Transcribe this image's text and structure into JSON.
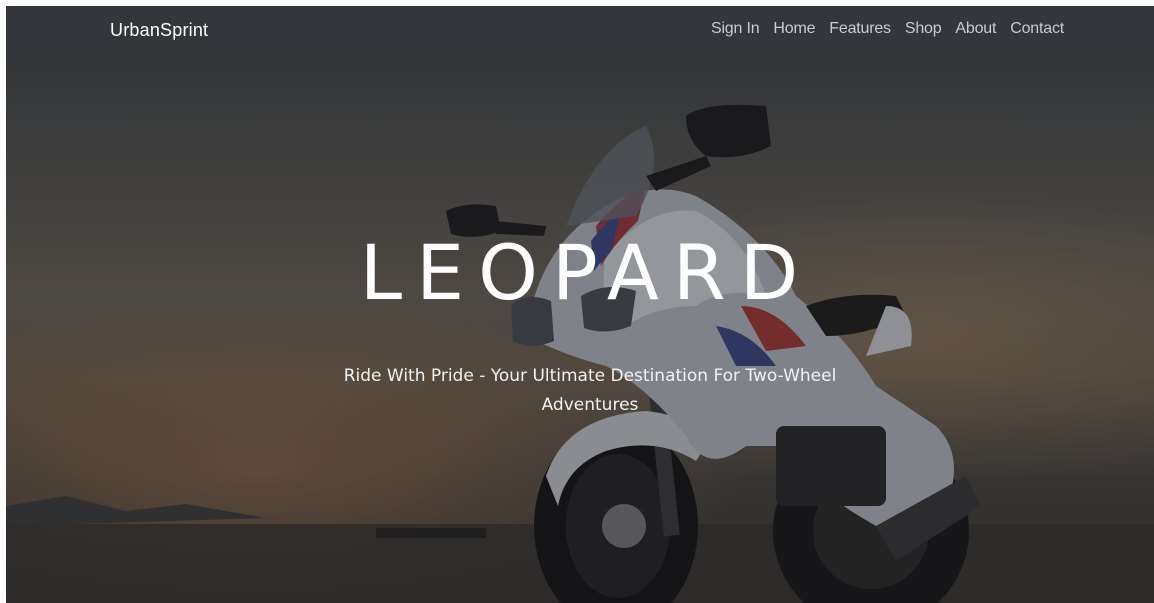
{
  "navbar": {
    "brand": "UrbanSprint",
    "links": [
      {
        "label": "Sign In"
      },
      {
        "label": "Home"
      },
      {
        "label": "Features"
      },
      {
        "label": "Shop"
      },
      {
        "label": "About"
      },
      {
        "label": "Contact"
      }
    ]
  },
  "hero": {
    "title": "LEOPARD",
    "subtitle": "Ride With Pride - Your Ultimate Destination For Two-Wheel Adventures",
    "background_image": "motorcycle-icon"
  }
}
